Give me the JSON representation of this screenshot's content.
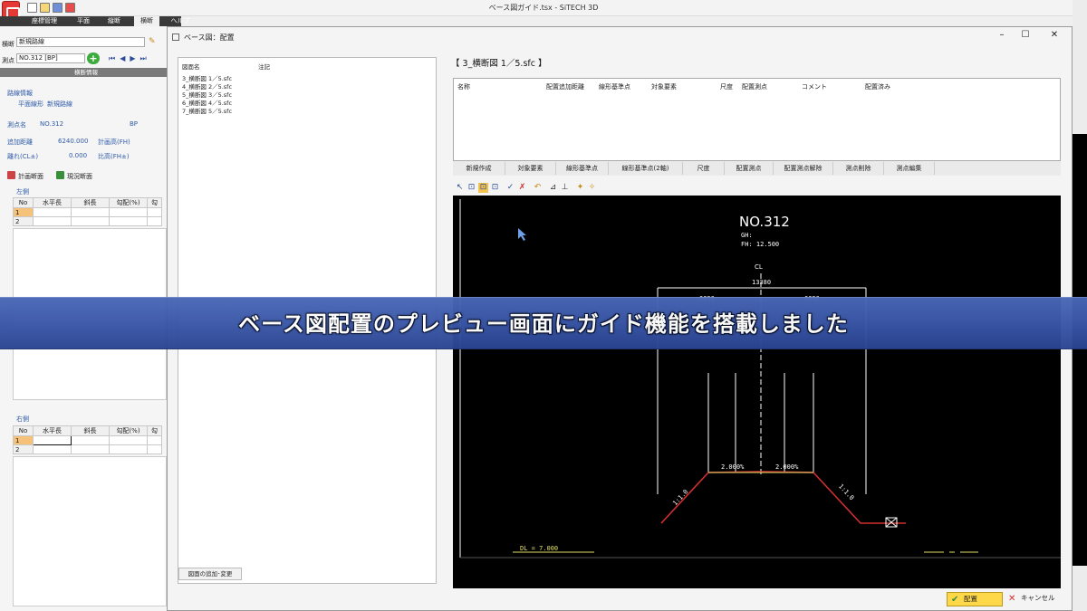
{
  "app": {
    "window_title": "ベース図ガイド.tsx - SiTECH 3D",
    "menus": [
      "座標管理",
      "平面",
      "縦断",
      "横断",
      "ヘルプ"
    ]
  },
  "left_panel": {
    "transverse_label": "横断",
    "transverse_value": "新規路線",
    "station_label": "測点",
    "station_value": "NO.312 [BP]",
    "section_header": "横断情報",
    "route_info": "路線情報",
    "plane_alignment_label": "平面線形",
    "plane_alignment_value": "新規路線",
    "station_name_label": "測点名",
    "station_name_value": "NO.312",
    "bp": "BP",
    "add_distance_label": "追加距離",
    "add_distance_value": "6240.000",
    "planned_height_label": "計画高(FH)",
    "offset_label": "離れ(CL±)",
    "offset_value": "0.000",
    "ratio_label": "比高(FH±)",
    "tab_plan": "計画断面",
    "tab_current": "現況断面",
    "left_side": "左側",
    "right_side": "右側",
    "grid_headers": [
      "No",
      "水平長",
      "斜長",
      "勾配(%)",
      "勾"
    ],
    "grid_rows": [
      "1",
      "2"
    ]
  },
  "dialog": {
    "title": "ベース図：配置",
    "list_col_name": "図面名",
    "list_col_note": "注記",
    "list_rows": [
      "3_横断図 1／5.sfc",
      "4_横断図 2／5.sfc",
      "5_横断図 3／5.sfc",
      "6_横断図 4／5.sfc",
      "7_横断図 5／5.sfc"
    ],
    "add_change_button": "図面の追加･変更",
    "file_title": "【 3_横断図 1／5.sfc 】",
    "table_headers": [
      "名称",
      "配置追加距離",
      "線形基準点",
      "対象要素",
      "尺度",
      "配置測点",
      "コメント",
      "配置済み"
    ],
    "tabs": [
      "新規作成",
      "対象要素",
      "線形基準点",
      "線形基準点(2軸)",
      "尺度",
      "配置測点",
      "配置測点解除",
      "測点削除",
      "測点編集"
    ],
    "place_button": "配置",
    "cancel_button": "キャンセル"
  },
  "cad": {
    "station": "NO.312",
    "gh": "GH:",
    "fh": "FH: 12.500",
    "cl": "CL",
    "width_dim": "13380",
    "dim_left": "6690",
    "dim_right": "6690",
    "slope_left": "2.000%",
    "slope_right": "2.000%",
    "side_slope_left": "1:1.0",
    "side_slope_right": "1:1.0",
    "datum": "DL = 7.000"
  },
  "banner": {
    "text": "ベース図配置のプレビュー画面にガイド機能を搭載しました"
  },
  "colors": {
    "banner_blue": "#3a57a8",
    "place_button_yellow": "#ffd84a",
    "cad_background": "#000000",
    "cad_profile_red": "#d32f2f",
    "cad_annotation_yellow": "#e6e06a"
  }
}
